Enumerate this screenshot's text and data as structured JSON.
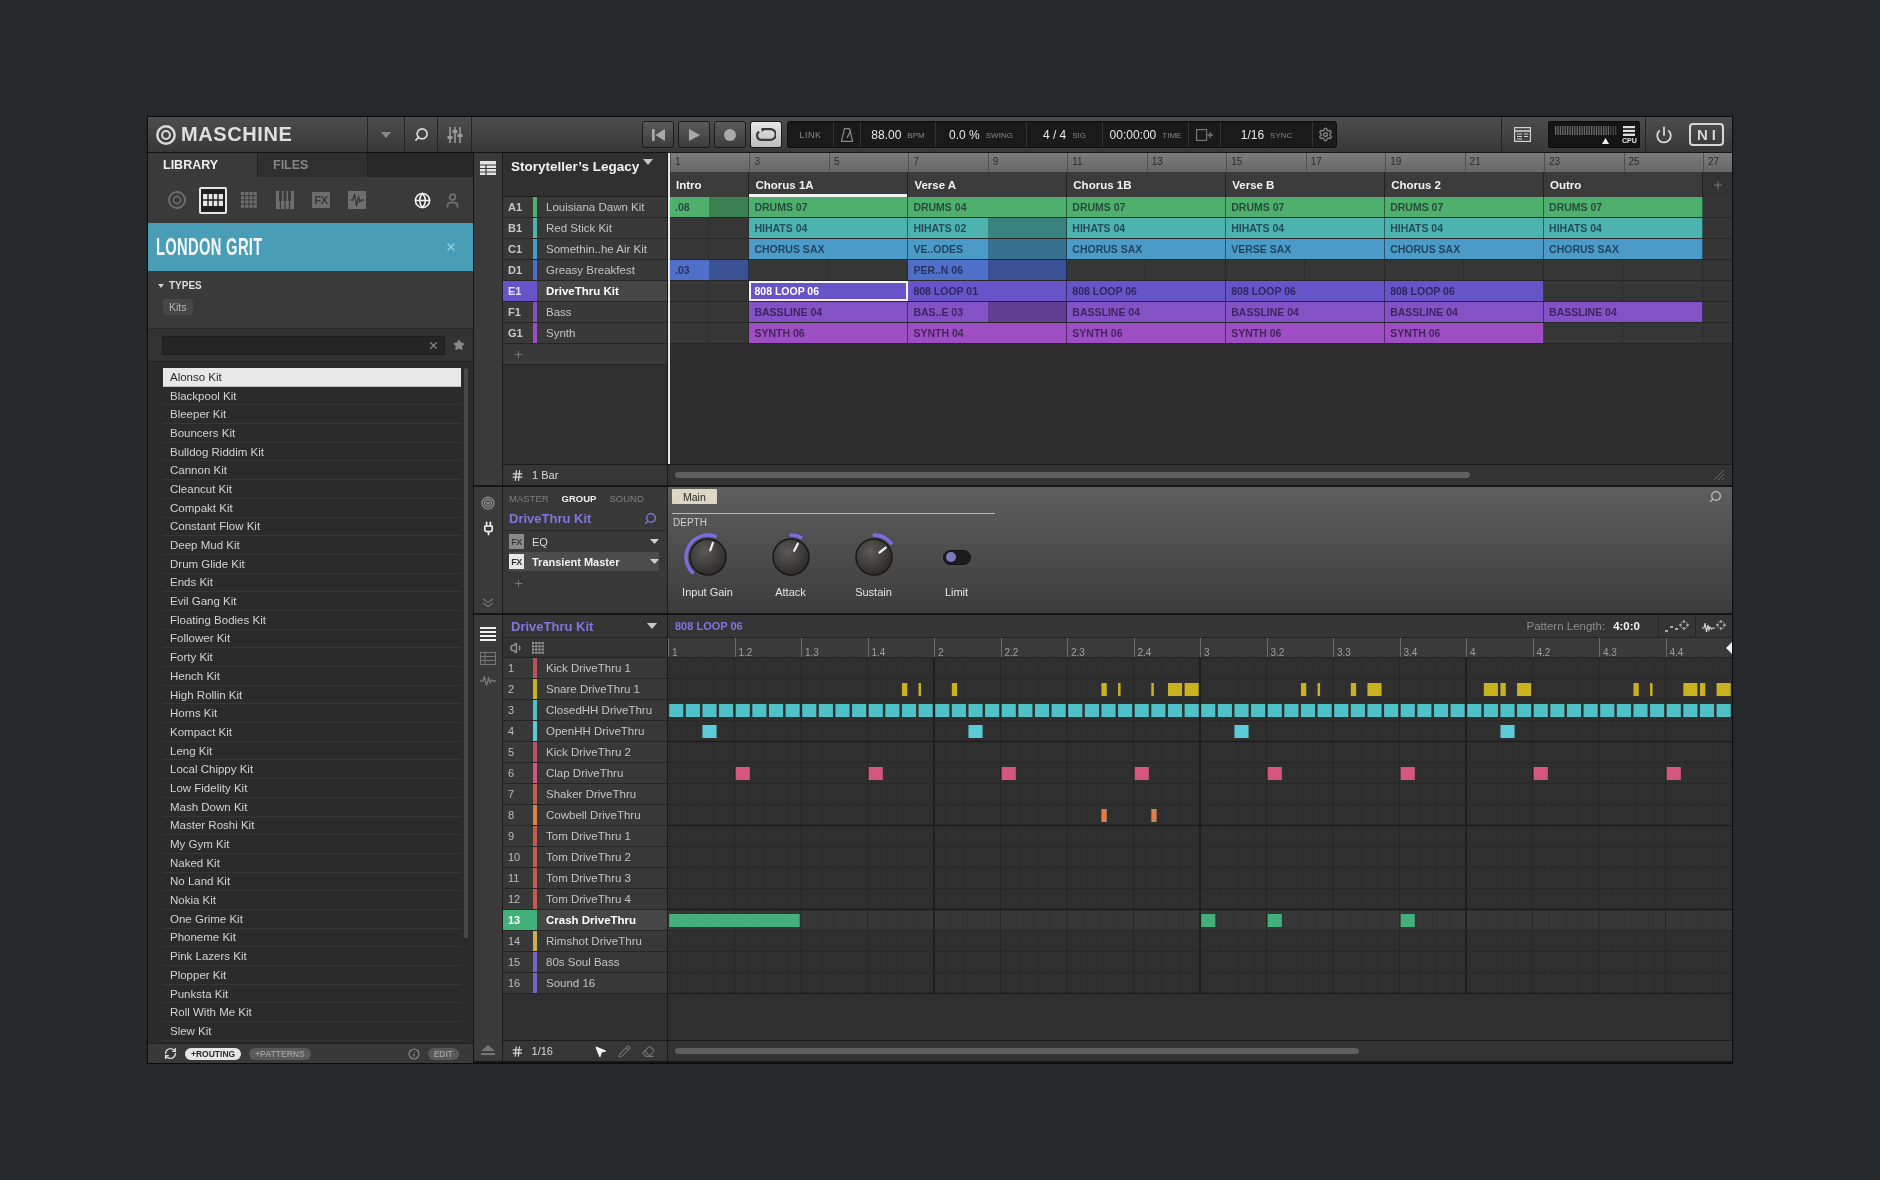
{
  "top_bar": {
    "logo": "MASCHINE",
    "transport": [
      {
        "kind": "rewind",
        "active": false
      },
      {
        "kind": "play",
        "active": false
      },
      {
        "kind": "record",
        "active": false
      },
      {
        "kind": "loop",
        "active": true
      }
    ],
    "link": "LINK",
    "tempo": {
      "value": "88.00",
      "unit": "BPM"
    },
    "swing": {
      "value": "0.0 %",
      "unit": "SWING"
    },
    "signature": {
      "value": "4 / 4",
      "unit": "SIG"
    },
    "time": {
      "value": "00:00:00",
      "unit": "TIME"
    },
    "sync": {
      "value": "1/16",
      "unit": "SYNC"
    },
    "cpu_label": "CPU",
    "brand_mark": "NI"
  },
  "browser": {
    "tabs": [
      {
        "label": "LIBRARY",
        "selected": true
      },
      {
        "label": "FILES",
        "selected": false
      }
    ],
    "type_filters": [
      {
        "kind": "plugin",
        "selected": false
      },
      {
        "kind": "group",
        "selected": true
      },
      {
        "kind": "sound",
        "selected": false
      },
      {
        "kind": "instrument",
        "selected": false
      },
      {
        "kind": "effect",
        "label": "FX",
        "selected": false
      },
      {
        "kind": "sample",
        "selected": false
      }
    ],
    "sources": [
      {
        "kind": "factory",
        "selected": true
      },
      {
        "kind": "user",
        "selected": false
      }
    ],
    "product": "LONDON GRIT",
    "types": {
      "label": "TYPES",
      "expanded": true,
      "chips": [
        "Kits"
      ]
    },
    "results": [
      {
        "label": "Alonso Kit",
        "selected": true
      },
      {
        "label": "Blackpool Kit",
        "selected": false
      },
      {
        "label": "Bleeper Kit",
        "selected": false
      },
      {
        "label": "Bouncers Kit",
        "selected": false
      },
      {
        "label": "Bulldog Riddim Kit",
        "selected": false
      },
      {
        "label": "Cannon Kit",
        "selected": false
      },
      {
        "label": "Cleancut Kit",
        "selected": false
      },
      {
        "label": "Compakt Kit",
        "selected": false
      },
      {
        "label": "Constant Flow Kit",
        "selected": false
      },
      {
        "label": "Deep Mud Kit",
        "selected": false
      },
      {
        "label": "Drum Glide Kit",
        "selected": false
      },
      {
        "label": "Ends Kit",
        "selected": false
      },
      {
        "label": "Evil Gang Kit",
        "selected": false
      },
      {
        "label": "Floating Bodies Kit",
        "selected": false
      },
      {
        "label": "Follower Kit",
        "selected": false
      },
      {
        "label": "Forty Kit",
        "selected": false
      },
      {
        "label": "Hench Kit",
        "selected": false
      },
      {
        "label": "High Rollin Kit",
        "selected": false
      },
      {
        "label": "Horns Kit",
        "selected": false
      },
      {
        "label": "Kompact Kit",
        "selected": false
      },
      {
        "label": "Leng Kit",
        "selected": false
      },
      {
        "label": "Local Chippy Kit",
        "selected": false
      },
      {
        "label": "Low Fidelity Kit",
        "selected": false
      },
      {
        "label": "Mash Down Kit",
        "selected": false
      },
      {
        "label": "Master Roshi Kit",
        "selected": false
      },
      {
        "label": "My Gym Kit",
        "selected": false
      },
      {
        "label": "Naked Kit",
        "selected": false
      },
      {
        "label": "No Land Kit",
        "selected": false
      },
      {
        "label": "Nokia Kit",
        "selected": false
      },
      {
        "label": "One Grime Kit",
        "selected": false
      },
      {
        "label": "Phoneme Kit",
        "selected": false
      },
      {
        "label": "Pink Lazers Kit",
        "selected": false
      },
      {
        "label": "Plopper Kit",
        "selected": false
      },
      {
        "label": "Punksta Kit",
        "selected": false
      },
      {
        "label": "Roll With Me Kit",
        "selected": false
      },
      {
        "label": "Slew Kit",
        "selected": false
      }
    ],
    "toggles": [
      {
        "label": "+ROUTING",
        "on": true
      },
      {
        "label": "+PATTERNS",
        "on": false
      }
    ],
    "edit": {
      "label": "EDIT",
      "on": false
    }
  },
  "arranger": {
    "title": "Storyteller’s Legacy",
    "bar_numbers": [
      "1",
      "3",
      "5",
      "7",
      "9",
      "11",
      "13",
      "15",
      "17",
      "19",
      "21",
      "23",
      "25",
      "27"
    ],
    "scenes": [
      {
        "name": "Intro",
        "kind": "short",
        "selected": false
      },
      {
        "name": "Chorus 1A",
        "kind": "long",
        "selected": true
      },
      {
        "name": "Verse A",
        "kind": "long",
        "selected": false
      },
      {
        "name": "Chorus 1B",
        "kind": "long",
        "selected": false
      },
      {
        "name": "Verse B",
        "kind": "long",
        "selected": false
      },
      {
        "name": "Chorus 2",
        "kind": "long",
        "selected": false
      },
      {
        "name": "Outro",
        "kind": "long",
        "selected": false
      }
    ],
    "groups": [
      {
        "slot": "A1",
        "name": "Louisiana Dawn Kit",
        "color": "#4fb06e",
        "selected": false,
        "clips": [
          {
            "kind": "clip",
            "label": ".08",
            "repeated": true,
            "selected": false
          },
          {
            "kind": "clip",
            "label": "DRUMS 07",
            "repeated": false,
            "selected": false
          },
          {
            "kind": "clip",
            "label": "DRUMS 04",
            "repeated": false,
            "selected": false
          },
          {
            "kind": "clip",
            "label": "DRUMS 07",
            "repeated": false,
            "selected": false
          },
          {
            "kind": "clip",
            "label": "DRUMS 07",
            "repeated": false,
            "selected": false
          },
          {
            "kind": "clip",
            "label": "DRUMS 07",
            "repeated": false,
            "selected": false
          },
          {
            "kind": "clip",
            "label": "DRUMS 07",
            "repeated": false,
            "selected": false
          }
        ]
      },
      {
        "slot": "B1",
        "name": "Red Stick Kit",
        "color": "#4db3ae",
        "selected": false,
        "clips": [
          {
            "kind": "empty"
          },
          {
            "kind": "clip",
            "label": "HIHATS 04",
            "repeated": false,
            "selected": false
          },
          {
            "kind": "clip",
            "label": "HIHATS 02",
            "repeated": true,
            "selected": false
          },
          {
            "kind": "clip",
            "label": "HIHATS 04",
            "repeated": false,
            "selected": false
          },
          {
            "kind": "clip",
            "label": "HIHATS 04",
            "repeated": false,
            "selected": false
          },
          {
            "kind": "clip",
            "label": "HIHATS 04",
            "repeated": false,
            "selected": false
          },
          {
            "kind": "clip",
            "label": "HIHATS 04",
            "repeated": false,
            "selected": false
          }
        ]
      },
      {
        "slot": "C1",
        "name": "Somethin..he Air Kit",
        "color": "#4a9bc7",
        "selected": false,
        "clips": [
          {
            "kind": "empty"
          },
          {
            "kind": "clip",
            "label": "CHORUS SAX",
            "repeated": false,
            "selected": false
          },
          {
            "kind": "clip",
            "label": "VE..ODES",
            "repeated": true,
            "selected": false
          },
          {
            "kind": "clip",
            "label": "CHORUS SAX",
            "repeated": false,
            "selected": false
          },
          {
            "kind": "clip",
            "label": "VERSE SAX",
            "repeated": false,
            "selected": false
          },
          {
            "kind": "clip",
            "label": "CHORUS SAX",
            "repeated": false,
            "selected": false
          },
          {
            "kind": "clip",
            "label": "CHORUS SAX",
            "repeated": false,
            "selected": false
          }
        ]
      },
      {
        "slot": "D1",
        "name": "Greasy Breakfest",
        "color": "#4f70c9",
        "selected": false,
        "clips": [
          {
            "kind": "clip",
            "label": ".03",
            "repeated": true,
            "selected": false
          },
          {
            "kind": "empty"
          },
          {
            "kind": "clip",
            "label": "PER..N 06",
            "repeated": true,
            "selected": false
          },
          {
            "kind": "empty"
          },
          {
            "kind": "empty"
          },
          {
            "kind": "empty"
          },
          {
            "kind": "empty"
          }
        ]
      },
      {
        "slot": "E1",
        "name": "DriveThru Kit",
        "color": "#6654c8",
        "selected": true,
        "clips": [
          {
            "kind": "empty"
          },
          {
            "kind": "clip",
            "label": "808 LOOP 06",
            "repeated": false,
            "selected": true
          },
          {
            "kind": "clip",
            "label": "808 LOOP 01",
            "repeated": false,
            "selected": false
          },
          {
            "kind": "clip",
            "label": "808 LOOP 06",
            "repeated": false,
            "selected": false
          },
          {
            "kind": "clip",
            "label": "808 LOOP 06",
            "repeated": false,
            "selected": false
          },
          {
            "kind": "clip",
            "label": "808 LOOP 06",
            "repeated": false,
            "selected": false
          },
          {
            "kind": "empty"
          }
        ]
      },
      {
        "slot": "F1",
        "name": "Bass",
        "color": "#8552c5",
        "selected": false,
        "clips": [
          {
            "kind": "empty"
          },
          {
            "kind": "clip",
            "label": "BASSLINE 04",
            "repeated": false,
            "selected": false
          },
          {
            "kind": "clip",
            "label": "BAS..E 03",
            "repeated": true,
            "selected": false
          },
          {
            "kind": "clip",
            "label": "BASSLINE 04",
            "repeated": false,
            "selected": false
          },
          {
            "kind": "clip",
            "label": "BASSLINE 04",
            "repeated": false,
            "selected": false
          },
          {
            "kind": "clip",
            "label": "BASSLINE 04",
            "repeated": false,
            "selected": false
          },
          {
            "kind": "clip",
            "label": "BASSLINE 04",
            "repeated": false,
            "selected": false
          }
        ]
      },
      {
        "slot": "G1",
        "name": "Synth",
        "color": "#9d4ec3",
        "selected": false,
        "clips": [
          {
            "kind": "empty"
          },
          {
            "kind": "clip",
            "label": "SYNTH 06",
            "repeated": false,
            "selected": false
          },
          {
            "kind": "clip",
            "label": "SYNTH 04",
            "repeated": false,
            "selected": false
          },
          {
            "kind": "clip",
            "label": "SYNTH 06",
            "repeated": false,
            "selected": false
          },
          {
            "kind": "clip",
            "label": "SYNTH 06",
            "repeated": false,
            "selected": false
          },
          {
            "kind": "clip",
            "label": "SYNTH 06",
            "repeated": false,
            "selected": false
          },
          {
            "kind": "empty"
          }
        ]
      }
    ],
    "grid": "1 Bar"
  },
  "control": {
    "tabs": [
      {
        "label": "MASTER",
        "selected": false
      },
      {
        "label": "GROUP",
        "selected": true
      },
      {
        "label": "SOUND",
        "selected": false
      }
    ],
    "title": "DriveThru Kit",
    "fx_slots": [
      {
        "badge": "FX",
        "name": "EQ",
        "selected": false
      },
      {
        "badge": "FX",
        "name": "Transient Master",
        "selected": true
      }
    ],
    "pages": [
      {
        "label": "Main",
        "selected": true
      }
    ],
    "section": "DEPTH",
    "params": [
      {
        "kind": "knob",
        "label": "Input Gain",
        "level": 0.57,
        "bipolar": false
      },
      {
        "kind": "knob",
        "label": "Attack",
        "level": 0.6,
        "bipolar": true
      },
      {
        "kind": "knob",
        "label": "Sustain",
        "level": 0.69,
        "bipolar": true
      },
      {
        "kind": "switch",
        "label": "Limit",
        "on": false
      }
    ]
  },
  "pattern": {
    "group": "DriveThru Kit",
    "pattern": "808 LOOP 06",
    "length_label": "Pattern Length:",
    "length": "4:0:0",
    "ruler": [
      "1",
      "1.2",
      "1.3",
      "1.4",
      "2",
      "2.2",
      "2.3",
      "2.4",
      "3",
      "3.2",
      "3.3",
      "3.4",
      "4",
      "4.2",
      "4.3",
      "4.4"
    ],
    "sounds": [
      {
        "number": "1",
        "name": "Kick DriveThru 1",
        "color": "#b9525c",
        "selected": false
      },
      {
        "number": "2",
        "name": "Snare DriveThru 1",
        "color": "#c9b21e",
        "selected": false,
        "steps": [
          {
            "kind": "rest"
          },
          {
            "kind": "rest"
          },
          {
            "kind": "rest"
          },
          {
            "kind": "rest"
          },
          {
            "kind": "rest"
          },
          {
            "kind": "rest"
          },
          {
            "kind": "rest"
          },
          {
            "kind": "rest"
          },
          {
            "kind": "rest"
          },
          {
            "kind": "rest"
          },
          {
            "kind": "rest"
          },
          {
            "kind": "rest"
          },
          {
            "kind": "rest"
          },
          {
            "kind": "rest"
          },
          {
            "kind": "short"
          },
          {
            "kind": "tick"
          },
          {
            "kind": "rest"
          },
          {
            "kind": "short"
          },
          {
            "kind": "rest"
          },
          {
            "kind": "rest"
          },
          {
            "kind": "rest"
          },
          {
            "kind": "rest"
          },
          {
            "kind": "rest"
          },
          {
            "kind": "rest"
          },
          {
            "kind": "rest"
          },
          {
            "kind": "rest"
          },
          {
            "kind": "short"
          },
          {
            "kind": "tick"
          },
          {
            "kind": "rest"
          },
          {
            "kind": "tick"
          },
          {
            "kind": "note"
          },
          {
            "kind": "note"
          },
          {
            "kind": "rest"
          },
          {
            "kind": "rest"
          },
          {
            "kind": "rest"
          },
          {
            "kind": "rest"
          },
          {
            "kind": "rest"
          },
          {
            "kind": "rest"
          },
          {
            "kind": "short"
          },
          {
            "kind": "tick"
          },
          {
            "kind": "rest"
          },
          {
            "kind": "short"
          },
          {
            "kind": "note"
          },
          {
            "kind": "rest"
          },
          {
            "kind": "rest"
          },
          {
            "kind": "rest"
          },
          {
            "kind": "rest"
          },
          {
            "kind": "rest"
          },
          {
            "kind": "rest"
          },
          {
            "kind": "note"
          },
          {
            "kind": "short"
          },
          {
            "kind": "note"
          },
          {
            "kind": "rest"
          },
          {
            "kind": "rest"
          },
          {
            "kind": "rest"
          },
          {
            "kind": "rest"
          },
          {
            "kind": "rest"
          },
          {
            "kind": "rest"
          },
          {
            "kind": "short"
          },
          {
            "kind": "tick"
          },
          {
            "kind": "rest"
          },
          {
            "kind": "note"
          },
          {
            "kind": "short"
          },
          {
            "kind": "note"
          }
        ]
      },
      {
        "number": "3",
        "name": "ClosedHH DriveThru",
        "color": "#4fc2c8",
        "selected": false,
        "steps": [
          {
            "kind": "note"
          },
          {
            "kind": "note"
          },
          {
            "kind": "note"
          },
          {
            "kind": "note"
          },
          {
            "kind": "note"
          },
          {
            "kind": "note"
          },
          {
            "kind": "note"
          },
          {
            "kind": "note"
          },
          {
            "kind": "note"
          },
          {
            "kind": "note"
          },
          {
            "kind": "note"
          },
          {
            "kind": "note"
          },
          {
            "kind": "note"
          },
          {
            "kind": "note"
          },
          {
            "kind": "note"
          },
          {
            "kind": "note"
          },
          {
            "kind": "note"
          },
          {
            "kind": "note"
          },
          {
            "kind": "note"
          },
          {
            "kind": "note"
          },
          {
            "kind": "note"
          },
          {
            "kind": "note"
          },
          {
            "kind": "note"
          },
          {
            "kind": "note"
          },
          {
            "kind": "note"
          },
          {
            "kind": "note"
          },
          {
            "kind": "note"
          },
          {
            "kind": "note"
          },
          {
            "kind": "note"
          },
          {
            "kind": "note"
          },
          {
            "kind": "note"
          },
          {
            "kind": "note"
          },
          {
            "kind": "note"
          },
          {
            "kind": "note"
          },
          {
            "kind": "note"
          },
          {
            "kind": "note"
          },
          {
            "kind": "note"
          },
          {
            "kind": "note"
          },
          {
            "kind": "note"
          },
          {
            "kind": "note"
          },
          {
            "kind": "note"
          },
          {
            "kind": "note"
          },
          {
            "kind": "note"
          },
          {
            "kind": "note"
          },
          {
            "kind": "note"
          },
          {
            "kind": "note"
          },
          {
            "kind": "note"
          },
          {
            "kind": "note"
          },
          {
            "kind": "note"
          },
          {
            "kind": "note"
          },
          {
            "kind": "note"
          },
          {
            "kind": "note"
          },
          {
            "kind": "note"
          },
          {
            "kind": "note"
          },
          {
            "kind": "note"
          },
          {
            "kind": "note"
          },
          {
            "kind": "note"
          },
          {
            "kind": "note"
          },
          {
            "kind": "note"
          },
          {
            "kind": "note"
          },
          {
            "kind": "note"
          },
          {
            "kind": "note"
          },
          {
            "kind": "note"
          },
          {
            "kind": "note"
          }
        ]
      },
      {
        "number": "4",
        "name": "OpenHH DriveThru",
        "color": "#5ccbd8",
        "selected": false,
        "steps": [
          {
            "kind": "rest"
          },
          {
            "kind": "rest"
          },
          {
            "kind": "note"
          },
          {
            "kind": "rest"
          },
          {
            "kind": "rest"
          },
          {
            "kind": "rest"
          },
          {
            "kind": "rest"
          },
          {
            "kind": "rest"
          },
          {
            "kind": "rest"
          },
          {
            "kind": "rest"
          },
          {
            "kind": "rest"
          },
          {
            "kind": "rest"
          },
          {
            "kind": "rest"
          },
          {
            "kind": "rest"
          },
          {
            "kind": "rest"
          },
          {
            "kind": "rest"
          },
          {
            "kind": "rest"
          },
          {
            "kind": "rest"
          },
          {
            "kind": "note"
          },
          {
            "kind": "rest"
          },
          {
            "kind": "rest"
          },
          {
            "kind": "rest"
          },
          {
            "kind": "rest"
          },
          {
            "kind": "rest"
          },
          {
            "kind": "rest"
          },
          {
            "kind": "rest"
          },
          {
            "kind": "rest"
          },
          {
            "kind": "rest"
          },
          {
            "kind": "rest"
          },
          {
            "kind": "rest"
          },
          {
            "kind": "rest"
          },
          {
            "kind": "rest"
          },
          {
            "kind": "rest"
          },
          {
            "kind": "rest"
          },
          {
            "kind": "note"
          },
          {
            "kind": "rest"
          },
          {
            "kind": "rest"
          },
          {
            "kind": "rest"
          },
          {
            "kind": "rest"
          },
          {
            "kind": "rest"
          },
          {
            "kind": "rest"
          },
          {
            "kind": "rest"
          },
          {
            "kind": "rest"
          },
          {
            "kind": "rest"
          },
          {
            "kind": "rest"
          },
          {
            "kind": "rest"
          },
          {
            "kind": "rest"
          },
          {
            "kind": "rest"
          },
          {
            "kind": "rest"
          },
          {
            "kind": "rest"
          },
          {
            "kind": "note"
          },
          {
            "kind": "rest"
          },
          {
            "kind": "rest"
          },
          {
            "kind": "rest"
          },
          {
            "kind": "rest"
          },
          {
            "kind": "rest"
          },
          {
            "kind": "rest"
          },
          {
            "kind": "rest"
          },
          {
            "kind": "rest"
          },
          {
            "kind": "rest"
          },
          {
            "kind": "rest"
          },
          {
            "kind": "rest"
          },
          {
            "kind": "rest"
          },
          {
            "kind": "rest"
          }
        ]
      },
      {
        "number": "5",
        "name": "Kick DriveThru 2",
        "color": "#b9525c",
        "selected": false
      },
      {
        "number": "6",
        "name": "Clap DriveThru",
        "color": "#d5577f",
        "selected": false,
        "steps": [
          {
            "kind": "rest"
          },
          {
            "kind": "rest"
          },
          {
            "kind": "rest"
          },
          {
            "kind": "rest"
          },
          {
            "kind": "note"
          },
          {
            "kind": "rest"
          },
          {
            "kind": "rest"
          },
          {
            "kind": "rest"
          },
          {
            "kind": "rest"
          },
          {
            "kind": "rest"
          },
          {
            "kind": "rest"
          },
          {
            "kind": "rest"
          },
          {
            "kind": "note"
          },
          {
            "kind": "rest"
          },
          {
            "kind": "rest"
          },
          {
            "kind": "rest"
          },
          {
            "kind": "rest"
          },
          {
            "kind": "rest"
          },
          {
            "kind": "rest"
          },
          {
            "kind": "rest"
          },
          {
            "kind": "note"
          },
          {
            "kind": "rest"
          },
          {
            "kind": "rest"
          },
          {
            "kind": "rest"
          },
          {
            "kind": "rest"
          },
          {
            "kind": "rest"
          },
          {
            "kind": "rest"
          },
          {
            "kind": "rest"
          },
          {
            "kind": "note"
          },
          {
            "kind": "rest"
          },
          {
            "kind": "rest"
          },
          {
            "kind": "rest"
          },
          {
            "kind": "rest"
          },
          {
            "kind": "rest"
          },
          {
            "kind": "rest"
          },
          {
            "kind": "rest"
          },
          {
            "kind": "note"
          },
          {
            "kind": "rest"
          },
          {
            "kind": "rest"
          },
          {
            "kind": "rest"
          },
          {
            "kind": "rest"
          },
          {
            "kind": "rest"
          },
          {
            "kind": "rest"
          },
          {
            "kind": "rest"
          },
          {
            "kind": "note"
          },
          {
            "kind": "rest"
          },
          {
            "kind": "rest"
          },
          {
            "kind": "rest"
          },
          {
            "kind": "rest"
          },
          {
            "kind": "rest"
          },
          {
            "kind": "rest"
          },
          {
            "kind": "rest"
          },
          {
            "kind": "note"
          },
          {
            "kind": "rest"
          },
          {
            "kind": "rest"
          },
          {
            "kind": "rest"
          },
          {
            "kind": "rest"
          },
          {
            "kind": "rest"
          },
          {
            "kind": "rest"
          },
          {
            "kind": "rest"
          },
          {
            "kind": "note"
          },
          {
            "kind": "rest"
          },
          {
            "kind": "rest"
          },
          {
            "kind": "rest"
          }
        ]
      },
      {
        "number": "7",
        "name": "Shaker DriveThru",
        "color": "#c4594e",
        "selected": false
      },
      {
        "number": "8",
        "name": "Cowbell DriveThru",
        "color": "#d9824a",
        "selected": false,
        "steps": [
          {
            "kind": "rest"
          },
          {
            "kind": "rest"
          },
          {
            "kind": "rest"
          },
          {
            "kind": "rest"
          },
          {
            "kind": "rest"
          },
          {
            "kind": "rest"
          },
          {
            "kind": "rest"
          },
          {
            "kind": "rest"
          },
          {
            "kind": "rest"
          },
          {
            "kind": "rest"
          },
          {
            "kind": "rest"
          },
          {
            "kind": "rest"
          },
          {
            "kind": "rest"
          },
          {
            "kind": "rest"
          },
          {
            "kind": "rest"
          },
          {
            "kind": "rest"
          },
          {
            "kind": "rest"
          },
          {
            "kind": "rest"
          },
          {
            "kind": "rest"
          },
          {
            "kind": "rest"
          },
          {
            "kind": "rest"
          },
          {
            "kind": "rest"
          },
          {
            "kind": "rest"
          },
          {
            "kind": "rest"
          },
          {
            "kind": "rest"
          },
          {
            "kind": "rest"
          },
          {
            "kind": "short"
          },
          {
            "kind": "rest"
          },
          {
            "kind": "rest"
          },
          {
            "kind": "short"
          },
          {
            "kind": "rest"
          },
          {
            "kind": "rest"
          },
          {
            "kind": "rest"
          },
          {
            "kind": "rest"
          },
          {
            "kind": "rest"
          },
          {
            "kind": "rest"
          },
          {
            "kind": "rest"
          },
          {
            "kind": "rest"
          },
          {
            "kind": "rest"
          },
          {
            "kind": "rest"
          },
          {
            "kind": "rest"
          },
          {
            "kind": "rest"
          },
          {
            "kind": "rest"
          },
          {
            "kind": "rest"
          },
          {
            "kind": "rest"
          },
          {
            "kind": "rest"
          },
          {
            "kind": "rest"
          },
          {
            "kind": "rest"
          },
          {
            "kind": "rest"
          },
          {
            "kind": "rest"
          },
          {
            "kind": "rest"
          },
          {
            "kind": "rest"
          },
          {
            "kind": "rest"
          },
          {
            "kind": "rest"
          },
          {
            "kind": "rest"
          },
          {
            "kind": "rest"
          },
          {
            "kind": "rest"
          },
          {
            "kind": "rest"
          },
          {
            "kind": "rest"
          },
          {
            "kind": "rest"
          },
          {
            "kind": "rest"
          },
          {
            "kind": "rest"
          },
          {
            "kind": "rest"
          },
          {
            "kind": "rest"
          }
        ]
      },
      {
        "number": "9",
        "name": "Tom DriveThru 1",
        "color": "#c4594e",
        "selected": false
      },
      {
        "number": "10",
        "name": "Tom DriveThru 2",
        "color": "#c4594e",
        "selected": false
      },
      {
        "number": "11",
        "name": "Tom DriveThru 3",
        "color": "#c4594e",
        "selected": false
      },
      {
        "number": "12",
        "name": "Tom DriveThru 4",
        "color": "#c4594e",
        "selected": false
      },
      {
        "number": "13",
        "name": "Crash DriveThru",
        "color": "#43b07c",
        "selected": true,
        "steps": [
          {
            "kind": "note"
          },
          {
            "kind": "tie"
          },
          {
            "kind": "tie"
          },
          {
            "kind": "tie"
          },
          {
            "kind": "tie"
          },
          {
            "kind": "tie"
          },
          {
            "kind": "tie"
          },
          {
            "kind": "tie"
          },
          {
            "kind": "rest"
          },
          {
            "kind": "rest"
          },
          {
            "kind": "rest"
          },
          {
            "kind": "rest"
          },
          {
            "kind": "rest"
          },
          {
            "kind": "rest"
          },
          {
            "kind": "rest"
          },
          {
            "kind": "rest"
          },
          {
            "kind": "rest"
          },
          {
            "kind": "rest"
          },
          {
            "kind": "rest"
          },
          {
            "kind": "rest"
          },
          {
            "kind": "rest"
          },
          {
            "kind": "rest"
          },
          {
            "kind": "rest"
          },
          {
            "kind": "rest"
          },
          {
            "kind": "rest"
          },
          {
            "kind": "rest"
          },
          {
            "kind": "rest"
          },
          {
            "kind": "rest"
          },
          {
            "kind": "rest"
          },
          {
            "kind": "rest"
          },
          {
            "kind": "rest"
          },
          {
            "kind": "rest"
          },
          {
            "kind": "note"
          },
          {
            "kind": "rest"
          },
          {
            "kind": "rest"
          },
          {
            "kind": "rest"
          },
          {
            "kind": "note"
          },
          {
            "kind": "rest"
          },
          {
            "kind": "rest"
          },
          {
            "kind": "rest"
          },
          {
            "kind": "rest"
          },
          {
            "kind": "rest"
          },
          {
            "kind": "rest"
          },
          {
            "kind": "rest"
          },
          {
            "kind": "note"
          },
          {
            "kind": "rest"
          },
          {
            "kind": "rest"
          },
          {
            "kind": "rest"
          },
          {
            "kind": "rest"
          },
          {
            "kind": "rest"
          },
          {
            "kind": "rest"
          },
          {
            "kind": "rest"
          },
          {
            "kind": "rest"
          },
          {
            "kind": "rest"
          },
          {
            "kind": "rest"
          },
          {
            "kind": "rest"
          },
          {
            "kind": "rest"
          },
          {
            "kind": "rest"
          },
          {
            "kind": "rest"
          },
          {
            "kind": "rest"
          },
          {
            "kind": "rest"
          },
          {
            "kind": "rest"
          },
          {
            "kind": "rest"
          },
          {
            "kind": "rest"
          }
        ]
      },
      {
        "number": "14",
        "name": "Rimshot DriveThru",
        "color": "#cdb04e",
        "selected": false
      },
      {
        "number": "15",
        "name": "80s Soul Bass",
        "color": "#7464c4",
        "selected": false
      },
      {
        "number": "16",
        "name": "Sound 16",
        "color": "#7464c4",
        "selected": false
      }
    ],
    "grid": "1/16",
    "tools": [
      {
        "kind": "select",
        "selected": true
      },
      {
        "kind": "draw",
        "selected": false
      },
      {
        "kind": "erase",
        "selected": false
      }
    ]
  }
}
